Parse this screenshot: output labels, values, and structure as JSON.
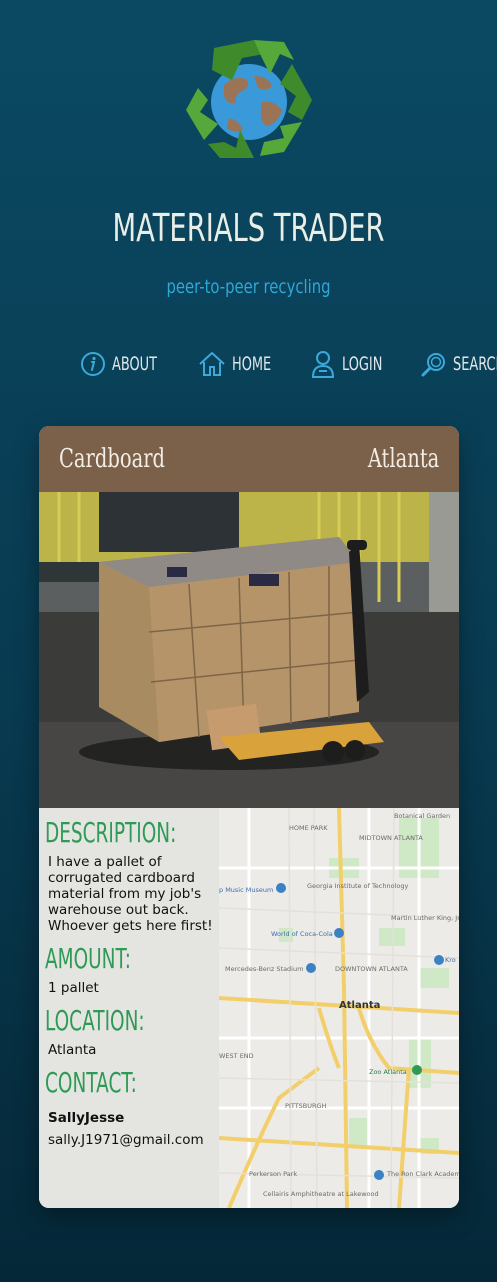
{
  "header": {
    "title": "MATERIALS TRADER",
    "tagline": "peer-to-peer recycling",
    "logo_icon": "recycle-globe-icon"
  },
  "nav": {
    "items": [
      {
        "label": "ABOUT",
        "icon": "info-icon"
      },
      {
        "label": "HOME",
        "icon": "home-icon"
      },
      {
        "label": "LOGIN",
        "icon": "user-icon"
      },
      {
        "label": "SEARCH",
        "icon": "search-icon"
      }
    ]
  },
  "listing": {
    "material": "Cardboard",
    "city": "Atlanta",
    "description_heading": "DESCRIPTION:",
    "description": "I have a pallet of corrugated cardboard material from my job's warehouse out back. Whoever gets here first!",
    "amount_heading": "AMOUNT:",
    "amount": "1 pallet",
    "location_heading": "LOCATION:",
    "location": "Atlanta",
    "contact_heading": "CONTACT:",
    "contact_name": "SallyJesse",
    "contact_email": "sally.J1971@gmail.com"
  },
  "map": {
    "labels": {
      "home_park": "HOME PARK",
      "midtown": "MIDTOWN ATLANTA",
      "botanical": "Botanical Garden",
      "georgia_tech": "Georgia Institute of Technology",
      "music_museum": "p Music Museum",
      "coca_cola": "World of Coca-Cola",
      "mlk": "Martin Luther King, Jr. National Historical Park",
      "mercedes": "Mercedes-Benz Stadium",
      "downtown": "DOWNTOWN ATLANTA",
      "atlanta": "Atlanta",
      "west_end": "WEST END",
      "zoo": "Zoo Atlanta",
      "pittsburgh": "PITTSBURGH",
      "perkerson": "Perkerson Park",
      "ron_clark": "The Ron Clark Academy",
      "cellairis": "Cellairis Amphitheatre at Lakewood",
      "kroger": "Kro"
    }
  },
  "colors": {
    "background": "#0b4963",
    "card_header": "#7b6149",
    "section_heading": "#2e9a55",
    "tagline": "#2fa8d8"
  }
}
